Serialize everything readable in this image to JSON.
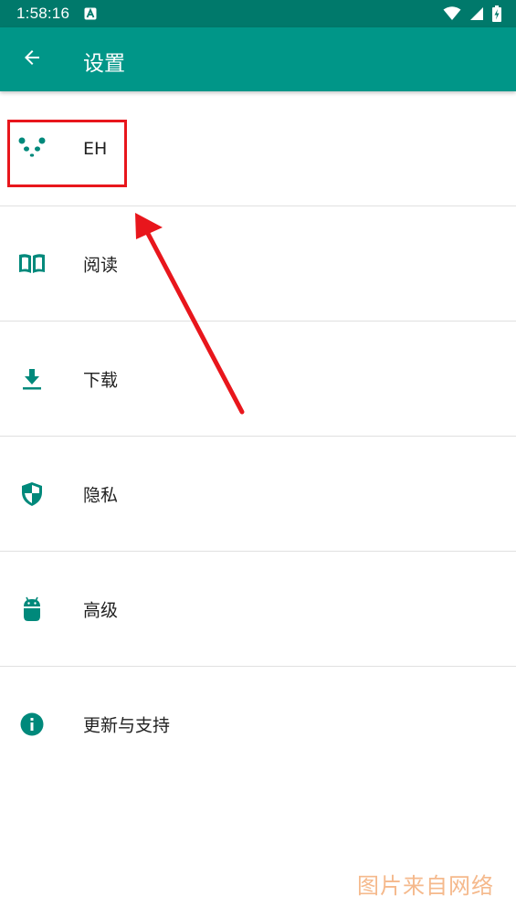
{
  "status_bar": {
    "time": "1:58:16",
    "notification_icon": "a-letter-icon",
    "icons": [
      "wifi-icon",
      "signal-icon",
      "battery-charging-icon"
    ]
  },
  "app_bar": {
    "back_icon": "arrow-back-icon",
    "title": "设置"
  },
  "settings": [
    {
      "label": "EH",
      "icon": "panda-icon"
    },
    {
      "label": "阅读",
      "icon": "book-icon"
    },
    {
      "label": "下载",
      "icon": "download-icon"
    },
    {
      "label": "隐私",
      "icon": "shield-icon"
    },
    {
      "label": "高级",
      "icon": "android-icon"
    },
    {
      "label": "更新与支持",
      "icon": "info-icon"
    }
  ],
  "annotation": {
    "color": "#e8161c"
  },
  "watermark": "图片来自网络",
  "colors": {
    "primary": "#009688",
    "primary_dark": "#00796b",
    "icon": "#00897b",
    "divider": "#e0e0e0"
  }
}
